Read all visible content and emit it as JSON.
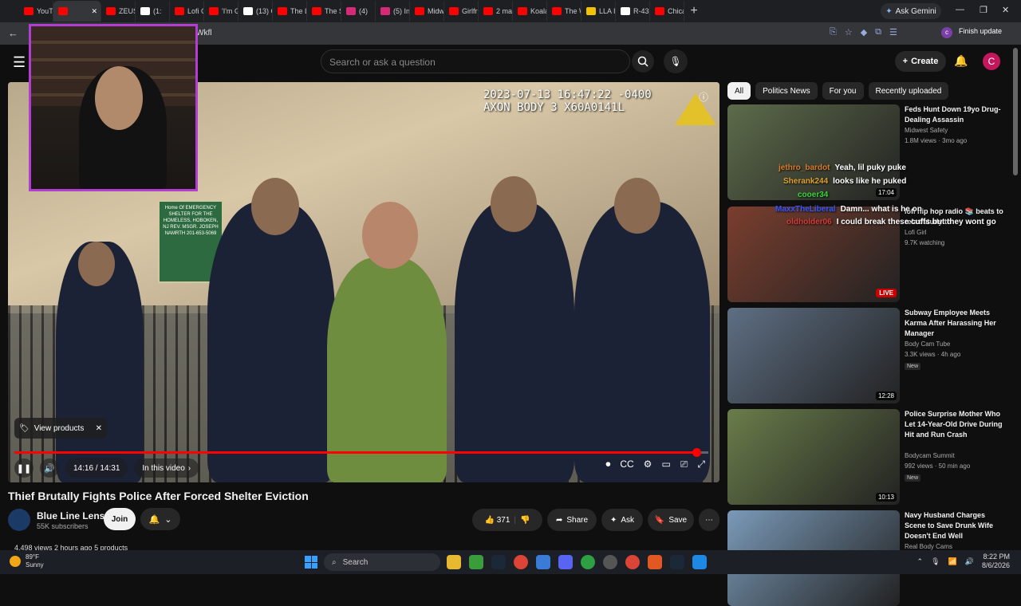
{
  "browser": {
    "tabs": [
      {
        "label": "YouTu",
        "color": "#ff0000"
      },
      {
        "label": "",
        "color": "#ff0000",
        "active": true
      },
      {
        "label": "ZEUS",
        "color": "#ff0000"
      },
      {
        "label": "(1:",
        "color": "#ffffff"
      },
      {
        "label": "Lofi G",
        "color": "#ff0000"
      },
      {
        "label": "'I'm G",
        "color": "#ff0000"
      },
      {
        "label": "(13) G",
        "color": "#ffffff"
      },
      {
        "label": "The La",
        "color": "#ff0000"
      },
      {
        "label": "The S",
        "color": "#ff0000"
      },
      {
        "label": "(4)",
        "color": "#d62976"
      },
      {
        "label": "(5) Ins",
        "color": "#d62976"
      },
      {
        "label": "Midw",
        "color": "#ff0000"
      },
      {
        "label": "Girlfri",
        "color": "#ff0000"
      },
      {
        "label": "2 mar",
        "color": "#ff0000"
      },
      {
        "label": "Koala",
        "color": "#ff0000"
      },
      {
        "label": "The W",
        "color": "#ff0000"
      },
      {
        "label": "LLA If",
        "color": "#f2c200"
      },
      {
        "label": "R-438",
        "color": "#ffffff"
      },
      {
        "label": "Chica",
        "color": "#ff0000"
      }
    ],
    "new_tab": "+",
    "ask_gemini": "Ask Gemini",
    "address_fragment": "Wkfl",
    "profile_initial": "c",
    "finish_update": "Finish update"
  },
  "youtube": {
    "search_placeholder": "Search or ask a question",
    "create_label": "Create",
    "avatar_initial": "C",
    "player": {
      "timestamp_line1": "2023-07-13 16:47:22 -0400",
      "timestamp_line2": "AXON BODY 3 X60A0141L",
      "sign_text": "Home Of EMERGENCY SHELTER FOR THE HOMELESS, HOBOKEN, NJ REV. MSGR. JOSEPH NAMRTH 201-653-5069",
      "view_products": "View products",
      "time_display": "14:16 / 14:31",
      "progress_fraction": 0.983,
      "in_this_video": "In this video"
    },
    "video": {
      "title": "Thief Brutally Fights Police After Forced Shelter Eviction",
      "channel": "Blue Line Lens",
      "subscribers": "55K subscribers",
      "join": "Join",
      "likes": "371",
      "share": "Share",
      "ask": "Ask",
      "save": "Save",
      "meta": "4,498 views  2 hours ago  5 products"
    },
    "chips": [
      "All",
      "Politics News",
      "For you",
      "Recently uploaded"
    ],
    "recommendations": [
      {
        "title": "Feds Hunt Down 19yo Drug-Dealing Assassin",
        "channel": "Midwest Safety",
        "meta": "1.8M views · 3mo ago",
        "duration": "17:04",
        "thumb_color": "#5d6b4a"
      },
      {
        "title": "lofi hip hop radio 📚 beats to relax/study to",
        "channel": "Lofi Girl",
        "meta": "9.7K watching",
        "live": "LIVE",
        "thumb_color": "#7a3e2e"
      },
      {
        "title": "Subway Employee Meets Karma After Harassing Her Manager",
        "channel": "Body Cam Tube",
        "meta": "3.3K views · 4h ago",
        "badge": "New",
        "duration": "12:28",
        "thumb_color": "#5e6f84"
      },
      {
        "title": "Police Surprise Mother Who Let 14-Year-Old Drive During Hit and Run Crash",
        "channel": "Bodycam Summit",
        "meta": "992 views · 50 min ago",
        "badge": "New",
        "duration": "10:13",
        "thumb_color": "#6a7d4a"
      },
      {
        "title": "Navy Husband Charges Scene to Save Drunk Wife Doesn't End Well",
        "channel": "Real Body Cams",
        "meta": "",
        "thumb_color": "#7a9ab8"
      }
    ],
    "chat_overlay": [
      {
        "user": "jethro_bardot",
        "msg": "Yeah, lil puky puke",
        "color": "#d97a2a"
      },
      {
        "user": "Sherank244",
        "msg": "looks like he puked",
        "color": "#e0a030"
      },
      {
        "user": "cooer34",
        "msg": "",
        "color": "#3ad43a"
      },
      {
        "user": "MaxxTheLiberal",
        "msg": "Damn... what is he on",
        "color": "#3355ff"
      },
      {
        "user": "oldholder06",
        "msg": "I could break these cuffs but they wont go",
        "color": "#d63a3a"
      }
    ]
  },
  "taskbar": {
    "temp": "89°F",
    "condition": "Sunny",
    "search": "Search",
    "time": "8:22 PM",
    "date": "8/6/2026"
  }
}
